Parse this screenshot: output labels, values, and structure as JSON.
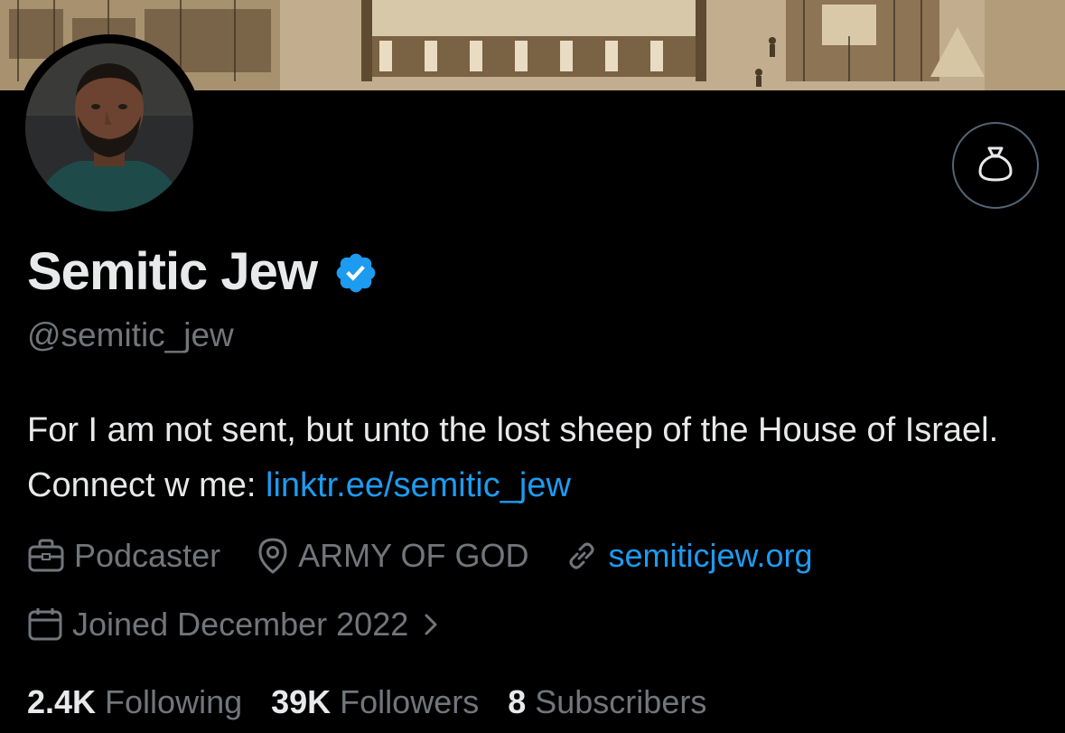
{
  "profile": {
    "display_name": "Semitic Jew",
    "handle": "@semitic_jew",
    "verified": true,
    "bio_text": "For I am not sent, but unto the lost sheep of the House of Israel. Connect w me: ",
    "bio_link": "linktr.ee/semitic_jew"
  },
  "meta": {
    "category": "Podcaster",
    "location": "ARMY OF GOD",
    "website": "semiticjew.org",
    "joined": "Joined December 2022"
  },
  "stats": {
    "following_count": "2.4K",
    "following_label": "Following",
    "followers_count": "39K",
    "followers_label": "Followers",
    "subscribers_count": "8",
    "subscribers_label": "Subscribers"
  },
  "icons": {
    "subscribe": "money-bag-icon",
    "verified": "verified-badge-icon",
    "category": "briefcase-icon",
    "location": "location-pin-icon",
    "website": "link-icon",
    "joined": "calendar-icon",
    "chevron": "chevron-right-icon"
  },
  "colors": {
    "background": "#000000",
    "primary_text": "#e7e9ea",
    "secondary_text": "#71767b",
    "link": "#1d9bf0",
    "verified_badge": "#1d9bf0"
  }
}
